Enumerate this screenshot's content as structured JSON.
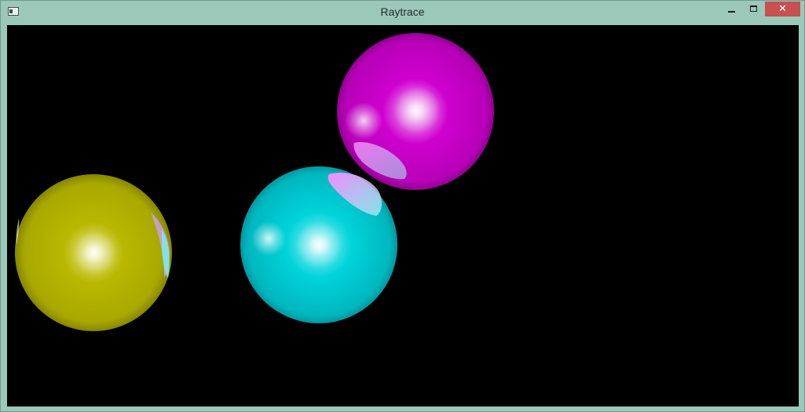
{
  "window": {
    "title": "Raytrace",
    "controls": {
      "minimize": "minimize",
      "maximize": "maximize",
      "close": "close",
      "close_glyph": "✕"
    },
    "app_icon": "window-icon"
  },
  "scene": {
    "background": "#000000",
    "spheres": [
      {
        "name": "yellow-sphere",
        "color": "#b4b400"
      },
      {
        "name": "cyan-sphere",
        "color": "#00d0d6"
      },
      {
        "name": "magenta-sphere",
        "color": "#cc00cc"
      }
    ]
  }
}
